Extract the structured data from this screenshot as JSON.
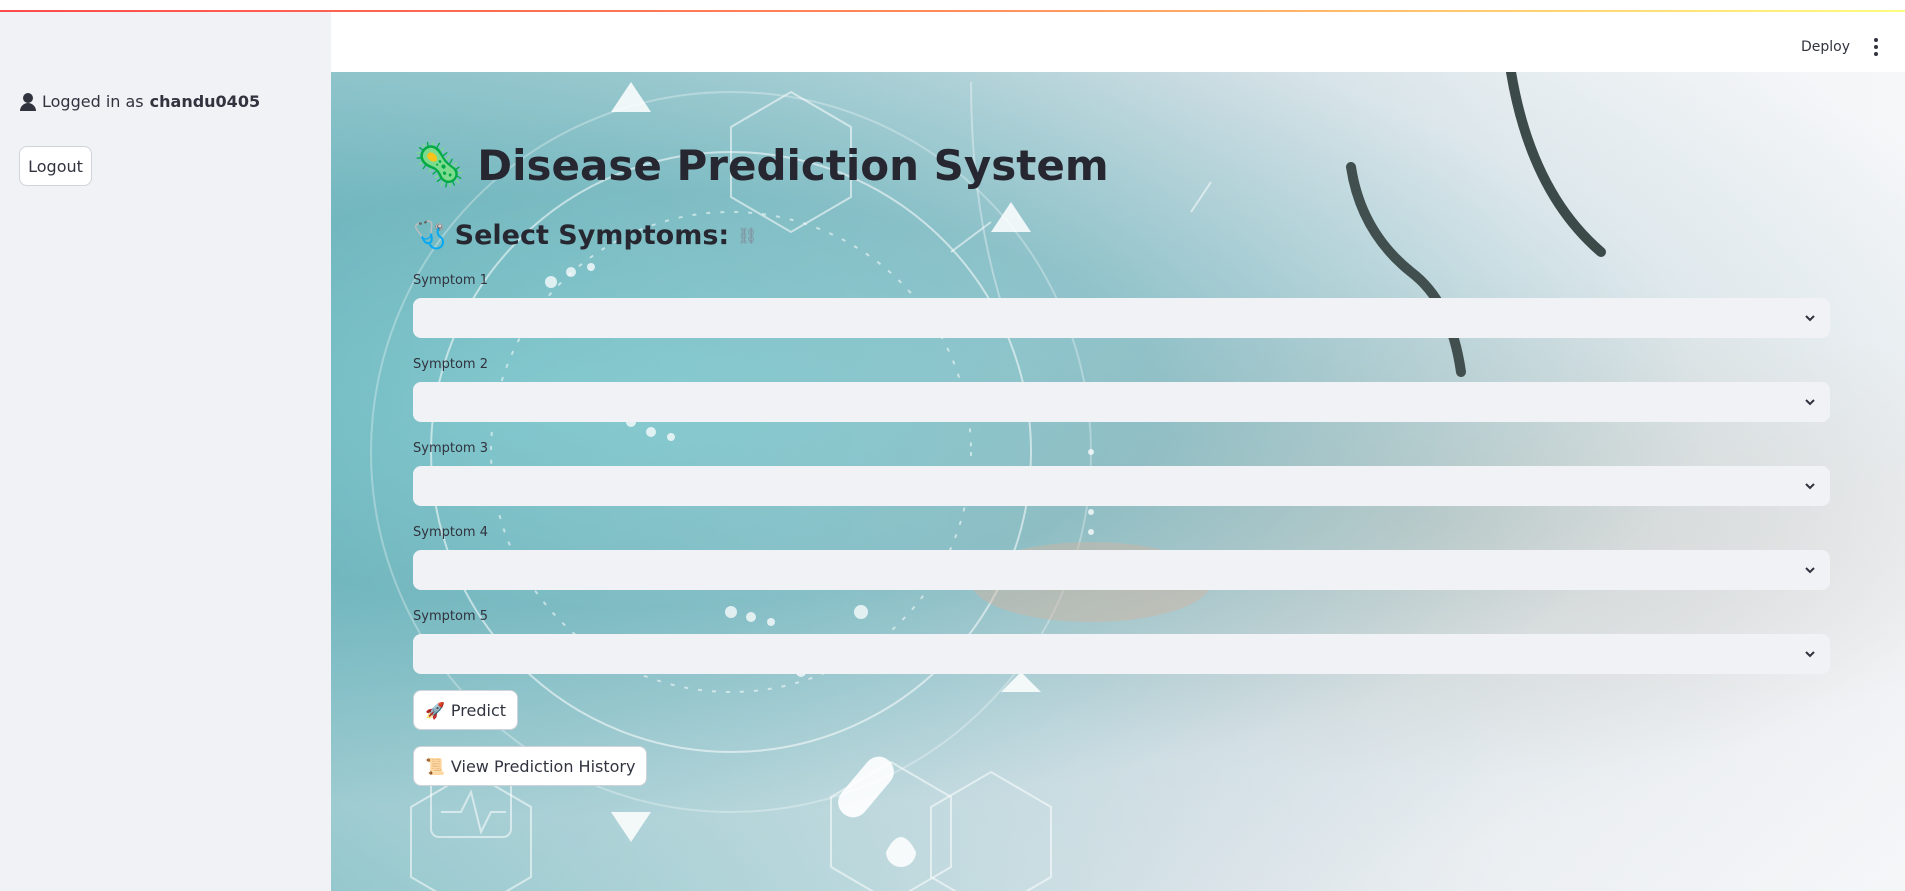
{
  "sidebar": {
    "logged_in_prefix": "Logged in as",
    "username": "chandu0405",
    "logout_label": "Logout"
  },
  "header": {
    "deploy_label": "Deploy"
  },
  "main": {
    "title_emoji": "🦠",
    "title": "Disease Prediction System",
    "subtitle_emoji": "🩺",
    "subtitle": "Select Symptoms:",
    "link_icon": "⛓",
    "symptoms": [
      {
        "label": "Symptom 1",
        "value": ""
      },
      {
        "label": "Symptom 2",
        "value": ""
      },
      {
        "label": "Symptom 3",
        "value": ""
      },
      {
        "label": "Symptom 4",
        "value": ""
      },
      {
        "label": "Symptom 5",
        "value": ""
      }
    ],
    "predict_emoji": "🚀",
    "predict_label": "Predict",
    "history_emoji": "📜",
    "history_label": "View Prediction History"
  },
  "colors": {
    "accent_stripe": "#ff4b4b",
    "sidebar_bg": "#f0f2f6",
    "select_bg": "#f0f2f6",
    "text": "#31333f"
  }
}
